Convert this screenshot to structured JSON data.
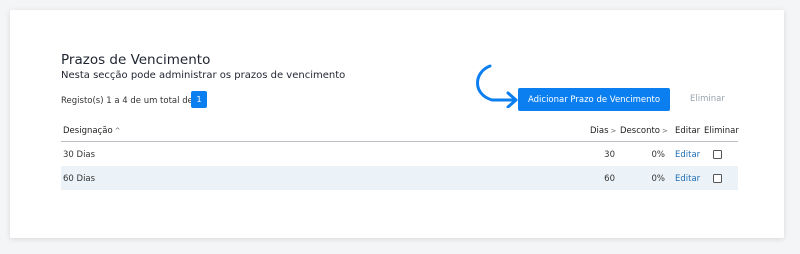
{
  "header": {
    "title": "Prazos de Vencimento",
    "subtitle": "Nesta secção pode administrar os prazos de vencimento"
  },
  "pagination": {
    "records_text": "Registo(s) 1 a 4 de um total de 4",
    "current_page": "1"
  },
  "actions": {
    "add_label": "Adicionar Prazo de Vencimento",
    "delete_label": "Eliminar"
  },
  "table": {
    "columns": {
      "designacao": "Designação",
      "dias": "Dias",
      "desconto": "Desconto",
      "editar": "Editar",
      "eliminar": "Eliminar"
    },
    "sort_up_icon": "^",
    "sort_right_icon": ">",
    "rows": [
      {
        "designacao": "30 Dias",
        "dias": "30",
        "desconto": "0%",
        "editar": "Editar"
      },
      {
        "designacao": "60 Dias",
        "dias": "60",
        "desconto": "0%",
        "editar": "Editar"
      }
    ]
  },
  "colors": {
    "accent": "#0b7ff0",
    "row_alt": "#ecf3f8",
    "muted_link": "#9aa4ad",
    "edit_link": "#1f6fb4"
  },
  "icons": {
    "curved_arrow": "curved-arrow-icon",
    "sort_asc": "chevron-up-icon",
    "sort": "chevron-right-icon",
    "checkbox": "checkbox-icon"
  }
}
